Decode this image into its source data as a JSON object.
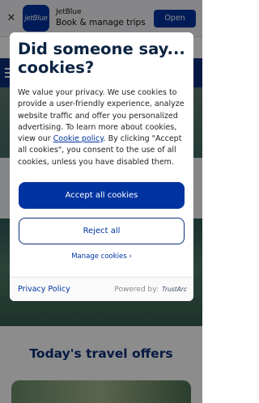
{
  "app_banner": {
    "close_glyph": "✕",
    "app_icon_text": "jetBlue",
    "app_name": "JetBlue",
    "subtitle": "Book & manage trips",
    "open_label": "Open"
  },
  "site": {
    "offers_title": "Today's travel offers"
  },
  "cookie_dialog": {
    "title": "Did someone say... cookies?",
    "body_start": "We value your privacy. We use cookies to provide a user-friendly experience, analyze website traffic and offer you personalized advertising. To learn more about cookies, view our ",
    "policy_link": "Cookie policy",
    "body_end": ". By clicking \"Accept all cookies\", you consent to the use of all cookies, unless you have disabled them.",
    "accept_label": "Accept all cookies",
    "reject_label": "Reject all",
    "manage_label": "Manage cookies ›",
    "privacy_label": "Privacy Policy",
    "powered_by": "Powered by:",
    "trustarc_label": "TrustArc"
  },
  "colors": {
    "brand_blue": "#0033a0",
    "navy": "#0b2e7a"
  }
}
